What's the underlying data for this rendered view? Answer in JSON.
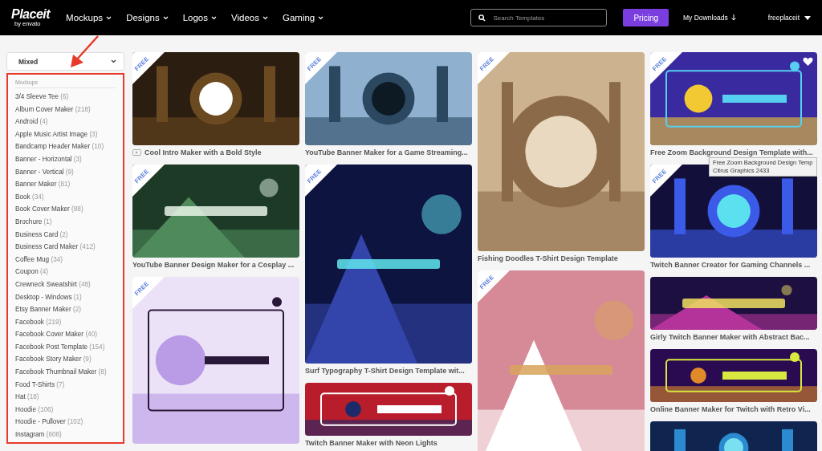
{
  "header": {
    "logo": {
      "name": "Placeit",
      "byline": "by envato"
    },
    "nav": [
      {
        "label": "Mockups"
      },
      {
        "label": "Designs"
      },
      {
        "label": "Logos"
      },
      {
        "label": "Videos"
      },
      {
        "label": "Gaming"
      }
    ],
    "search": {
      "placeholder": "Search Templates"
    },
    "pricing_button": "Pricing",
    "downloads": "My Downloads",
    "user": "freeplaceit"
  },
  "sidebar": {
    "filter": {
      "value": "Mixed"
    },
    "highlighted": true,
    "section_title": "Mockups",
    "categories": [
      {
        "name": "3/4 Sleeve Tee",
        "count": "(6)"
      },
      {
        "name": "Album Cover Maker",
        "count": "(218)"
      },
      {
        "name": "Android",
        "count": "(4)"
      },
      {
        "name": "Apple Music Artist Image",
        "count": "(3)"
      },
      {
        "name": "Bandcamp Header Maker",
        "count": "(10)"
      },
      {
        "name": "Banner - Horizontal",
        "count": "(3)"
      },
      {
        "name": "Banner - Vertical",
        "count": "(9)"
      },
      {
        "name": "Banner Maker",
        "count": "(81)"
      },
      {
        "name": "Book",
        "count": "(34)"
      },
      {
        "name": "Book Cover Maker",
        "count": "(88)"
      },
      {
        "name": "Brochure",
        "count": "(1)"
      },
      {
        "name": "Business Card",
        "count": "(2)"
      },
      {
        "name": "Business Card Maker",
        "count": "(412)"
      },
      {
        "name": "Coffee Mug",
        "count": "(34)"
      },
      {
        "name": "Coupon",
        "count": "(4)"
      },
      {
        "name": "Crewneck Sweatshirt",
        "count": "(48)"
      },
      {
        "name": "Desktop - Windows",
        "count": "(1)"
      },
      {
        "name": "Etsy Banner Maker",
        "count": "(2)"
      },
      {
        "name": "Facebook",
        "count": "(219)"
      },
      {
        "name": "Facebook Cover Maker",
        "count": "(40)"
      },
      {
        "name": "Facebook Post Template",
        "count": "(154)"
      },
      {
        "name": "Facebook Story Maker",
        "count": "(9)"
      },
      {
        "name": "Facebook Thumbnail Maker",
        "count": "(8)"
      },
      {
        "name": "Food T-Shirts",
        "count": "(7)"
      },
      {
        "name": "Hat",
        "count": "(18)"
      },
      {
        "name": "Hoodie",
        "count": "(106)"
      },
      {
        "name": "Hoodie - Pullover",
        "count": "(102)"
      },
      {
        "name": "Instagram",
        "count": "(608)"
      }
    ]
  },
  "gallery": {
    "columns": [
      [
        {
          "kind": "wide",
          "badge": "FREE",
          "video": true,
          "hovered": false,
          "caption": "Cool Intro Maker with a Bold Style"
        },
        {
          "kind": "wide",
          "badge": "FREE",
          "video": false,
          "hovered": false,
          "caption": "YouTube Banner Design Maker for a Cosplay ..."
        },
        {
          "kind": "square",
          "badge": "FREE",
          "video": false,
          "hovered": false
        }
      ],
      [
        {
          "kind": "wide",
          "badge": "FREE",
          "video": false,
          "hovered": false,
          "caption": "YouTube Banner Maker for a Game Streaming..."
        },
        {
          "kind": "portrait",
          "badge": "FREE",
          "video": false,
          "hovered": false,
          "caption": "Surf Typography T-Shirt Design Template wit..."
        },
        {
          "kind": "strip",
          "video": false,
          "hovered": false,
          "caption": "Twitch Banner Maker with Neon Lights"
        }
      ],
      [
        {
          "kind": "portrait",
          "badge": "FREE",
          "video": false,
          "hovered": false,
          "caption": "Fishing Doodles T-Shirt Design Template"
        },
        {
          "kind": "portrait",
          "badge": "FREE",
          "video": false,
          "hovered": false
        }
      ],
      [
        {
          "kind": "wide",
          "badge": "FREE",
          "video": false,
          "hovered": true,
          "caption": "Free Zoom Background Design Template with...",
          "tooltip": {
            "title": "Free Zoom Background Design Temp",
            "author": "Citrus Graphics 2433"
          }
        },
        {
          "kind": "wide",
          "badge": "FREE",
          "video": false,
          "hovered": false,
          "caption": "Twitch Banner Creator for Gaming Channels ..."
        },
        {
          "kind": "strip",
          "video": false,
          "hovered": false,
          "caption": "Girly Twitch Banner Maker with Abstract Bac..."
        },
        {
          "kind": "strip",
          "video": false,
          "hovered": false,
          "caption": "Online Banner Maker for Twitch with Retro Vi..."
        },
        {
          "kind": "strip",
          "video": false,
          "hovered": false
        }
      ]
    ]
  }
}
